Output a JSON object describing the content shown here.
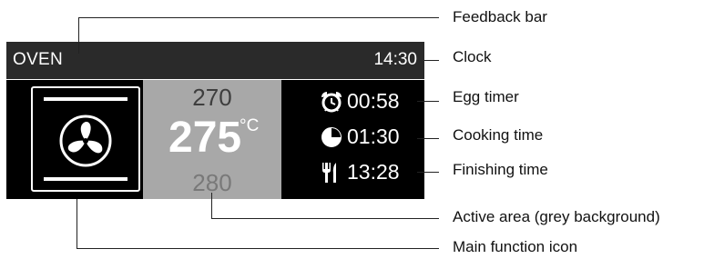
{
  "display": {
    "mode": "OVEN",
    "clock": "14:30",
    "temperature": {
      "previous": "270",
      "current": "275",
      "unit": "°C",
      "next": "280"
    },
    "timers": [
      {
        "icon": "alarm-clock-icon",
        "value": "00:58"
      },
      {
        "icon": "pie-timer-icon",
        "value": "01:30"
      },
      {
        "icon": "fork-knife-icon",
        "value": "13:28"
      }
    ]
  },
  "callouts": {
    "feedback_bar": "Feedback bar",
    "clock": "Clock",
    "egg_timer": "Egg timer",
    "cooking_time": "Cooking time",
    "finishing_time": "Finishing time",
    "active_area": "Active area (grey background)",
    "main_function_icon": "Main function icon"
  }
}
